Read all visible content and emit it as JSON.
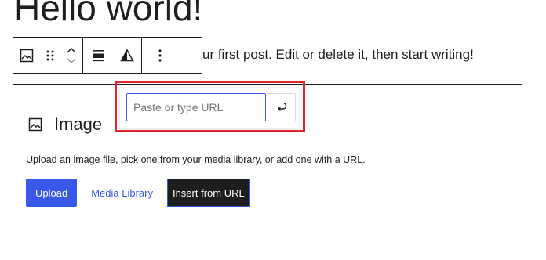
{
  "post": {
    "title": "Hello world!",
    "paragraph_visible": "ur first post. Edit or delete it, then start writing!"
  },
  "block_toolbar": {
    "items": [
      {
        "icon": "image-icon"
      },
      {
        "icon": "drag-handle-icon"
      },
      {
        "icon": "move-up-icon"
      },
      {
        "icon": "move-down-icon"
      },
      {
        "icon": "align-icon"
      },
      {
        "icon": "contrast-icon"
      },
      {
        "icon": "more-options-icon"
      }
    ]
  },
  "image_block": {
    "label": "Image",
    "instructions": "Upload an image file, pick one from your media library, or add one with a URL.",
    "upload_label": "Upload",
    "media_library_label": "Media Library",
    "insert_url_label": "Insert from URL"
  },
  "url_popover": {
    "placeholder": "Paste or type URL",
    "value": "",
    "submit_icon": "enter-icon"
  },
  "colors": {
    "accent": "#3858e9",
    "highlight": "#e2232a",
    "text": "#1e1e1e"
  }
}
